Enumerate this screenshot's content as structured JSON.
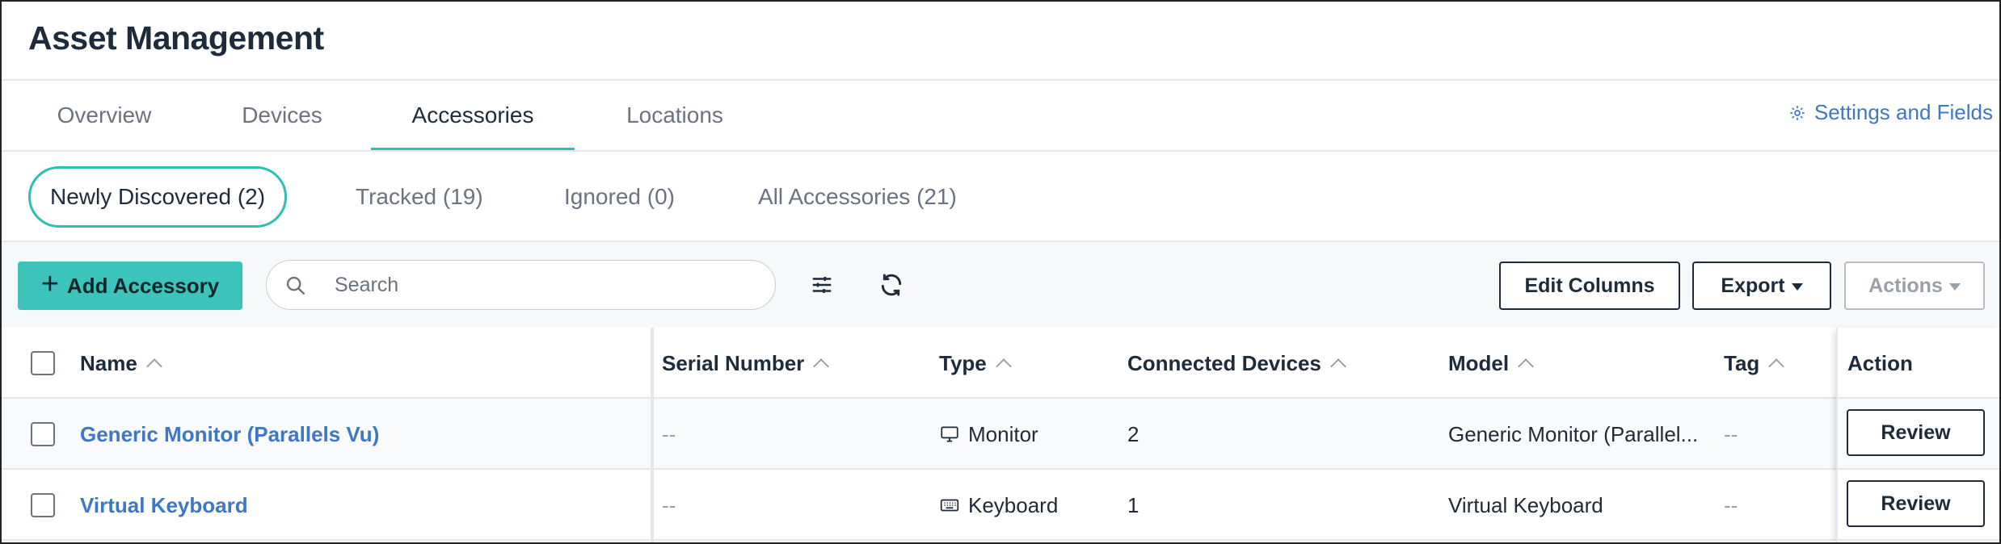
{
  "header": {
    "title": "Asset Management"
  },
  "tabs": [
    {
      "label": "Overview"
    },
    {
      "label": "Devices"
    },
    {
      "label": "Accessories"
    },
    {
      "label": "Locations"
    }
  ],
  "settings": {
    "label": "Settings and Fields",
    "icon": "gear-icon",
    "color": "#3e77c7"
  },
  "subtabs": [
    {
      "label": "Newly Discovered (2)"
    },
    {
      "label": "Tracked (19)"
    },
    {
      "label": "Ignored (0)"
    },
    {
      "label": "All Accessories (21)"
    }
  ],
  "toolbar": {
    "add_label": "Add Accessory",
    "search_placeholder": "Search",
    "edit_columns_label": "Edit Columns",
    "export_label": "Export",
    "actions_label": "Actions",
    "accent_color": "#3cc3ba"
  },
  "table": {
    "columns": {
      "name": "Name",
      "serial": "Serial Number",
      "type": "Type",
      "connected": "Connected Devices",
      "model": "Model",
      "tag": "Tag",
      "action": "Action"
    },
    "rows": [
      {
        "name": "Generic Monitor (Parallels Vu)",
        "serial": "--",
        "type": "Monitor",
        "type_icon": "monitor-icon",
        "connected": "2",
        "model": "Generic Monitor (Parallel...",
        "tag": "--",
        "action": "Review"
      },
      {
        "name": "Virtual Keyboard",
        "serial": "--",
        "type": "Keyboard",
        "type_icon": "keyboard-icon",
        "connected": "1",
        "model": "Virtual Keyboard",
        "tag": "--",
        "action": "Review"
      }
    ]
  }
}
